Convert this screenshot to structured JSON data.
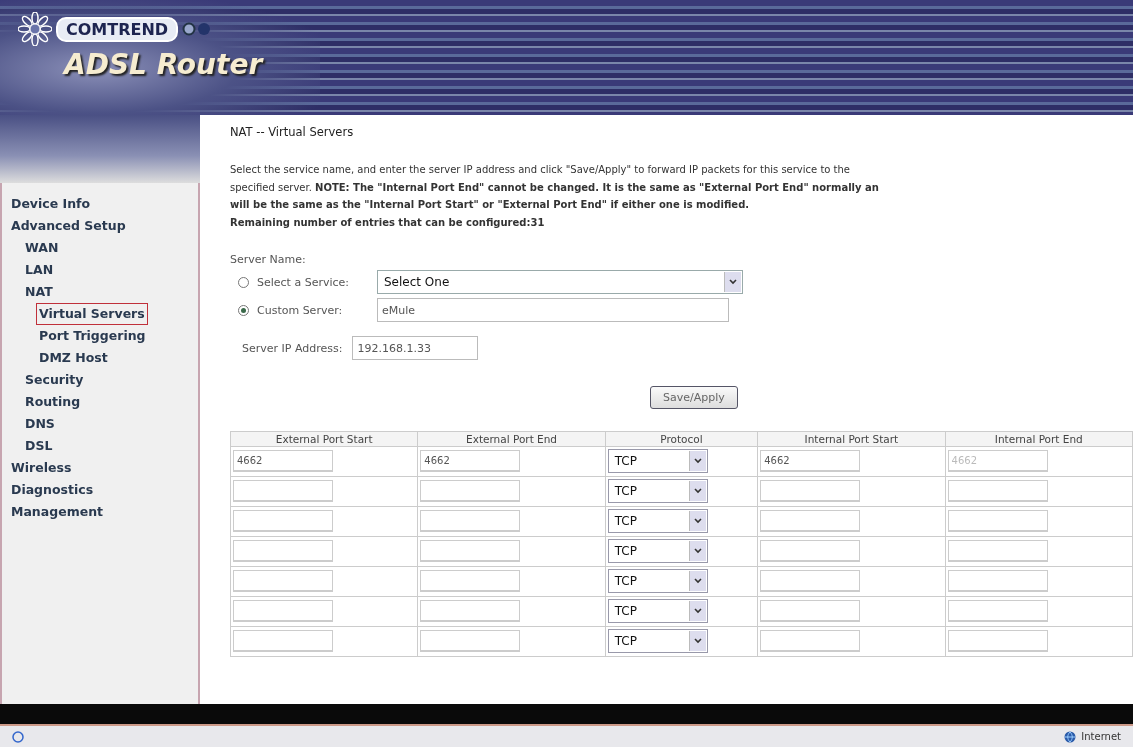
{
  "header": {
    "brand": "COMTREND",
    "product": "ADSL Router"
  },
  "sidebar": {
    "items": [
      {
        "label": "Device Info",
        "selected": false
      },
      {
        "label": "Advanced Setup",
        "selected": false,
        "children": [
          {
            "label": "WAN",
            "selected": false
          },
          {
            "label": "LAN",
            "selected": false
          },
          {
            "label": "NAT",
            "selected": false,
            "children": [
              {
                "label": "Virtual Servers",
                "selected": true
              },
              {
                "label": "Port Triggering",
                "selected": false
              },
              {
                "label": "DMZ Host",
                "selected": false
              }
            ]
          },
          {
            "label": "Security",
            "selected": false
          },
          {
            "label": "Routing",
            "selected": false
          },
          {
            "label": "DNS",
            "selected": false
          },
          {
            "label": "DSL",
            "selected": false
          }
        ]
      },
      {
        "label": "Wireless",
        "selected": false
      },
      {
        "label": "Diagnostics",
        "selected": false
      },
      {
        "label": "Management",
        "selected": false
      }
    ]
  },
  "page": {
    "title": "NAT -- Virtual Servers",
    "intro_lines": [
      "Select the service name, and enter the server IP address and click \"Save/Apply\" to forward IP packets for this service to the",
      "specified server. **NOTE: The \"Internal Port End\" cannot be changed. It is the same as \"External Port End\" normally an**",
      "**will be the same as the \"Internal Port Start\" or \"External Port End\" if either one is modified.**",
      "**Remaining number of entries that can be configured:31**"
    ],
    "server_name_label": "Server Name:",
    "server_options": [
      {
        "kind": "select",
        "label": "Select a Service:",
        "value": "Select One",
        "selected": false
      },
      {
        "kind": "text",
        "label": "Custom Server:",
        "value": "eMule",
        "selected": true
      }
    ],
    "ip_label": "Server IP Address:",
    "ip_value": "192.168.1.33",
    "save_button": "Save/Apply"
  },
  "table": {
    "columns": [
      "External Port Start",
      "External Port End",
      "Protocol",
      "Internal Port Start",
      "Internal Port End"
    ],
    "internal_end_disabled": true,
    "rows": [
      {
        "external_start": "4662",
        "external_end": "4662",
        "protocol": "TCP",
        "internal_start": "4662",
        "internal_end": "4662"
      },
      {
        "protocol": "TCP"
      },
      {
        "protocol": "TCP"
      },
      {
        "protocol": "TCP"
      },
      {
        "protocol": "TCP"
      },
      {
        "protocol": "TCP"
      },
      {
        "protocol": "TCP"
      }
    ]
  },
  "status_bar": {
    "zone": "Internet"
  }
}
